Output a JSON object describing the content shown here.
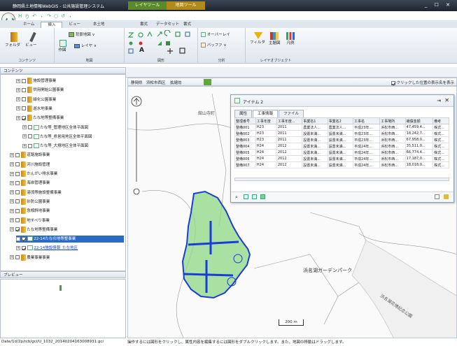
{
  "window": {
    "title": "静岡県土地情報WebGIS - 公共施設管理システム",
    "context_tab1": "レイヤツール",
    "context_tab2": "地図ツール",
    "controls": "_ ☐ ✕"
  },
  "qat": {
    "items": [
      "H",
      "り",
      "↶",
      "・",
      "↷",
      "○",
      "↺",
      "・"
    ]
  },
  "tabs": [
    "ホーム",
    "挿入",
    "ビュー",
    "本土地",
    "書式",
    "データセット",
    "書式"
  ],
  "ribbon": {
    "groups": [
      {
        "label": "コンテンツ",
        "buttons": [
          "フォルダ",
          "ビュー"
        ]
      },
      {
        "label": "地図",
        "buttons": [
          "背景地図 ∨",
          "作図",
          "レイヤ ∨"
        ]
      },
      {
        "label": "図形",
        "buttons": [
          "A"
        ]
      },
      {
        "label": "分析",
        "buttons": [
          "オーバーレイ",
          "バッファ ∨"
        ]
      },
      {
        "label": "レイヤオブジェクト",
        "buttons": [
          "フィルタ",
          "主題図",
          "凡例"
        ]
      }
    ]
  },
  "left_panel": {
    "contents_title": "コンテンツ",
    "preview_title": "プレビュー"
  },
  "tree": [
    {
      "indent": 2,
      "text": "施設管理事業",
      "checked": false
    },
    {
      "indent": 2,
      "text": "供用開始公園事業",
      "checked": false
    },
    {
      "indent": 2,
      "text": "緑化公園事業",
      "checked": false
    },
    {
      "indent": 2,
      "text": "遊水地事業",
      "checked": false
    },
    {
      "indent": 2,
      "text": "たな地等整備事業",
      "checked": true
    },
    {
      "indent": 3,
      "text": "たな等_管理地区全体平面図",
      "checked": false
    },
    {
      "indent": 3,
      "text": "たな等_県営用地区全体平面図",
      "checked": false
    },
    {
      "indent": 3,
      "text": "たな等_大規地区全体平面図",
      "checked": false
    },
    {
      "indent": 1,
      "text": "道路施設事業",
      "checked": false
    },
    {
      "indent": 1,
      "text": "河川施設管理",
      "checked": false
    },
    {
      "indent": 1,
      "text": "かんがい排水事業",
      "checked": false
    },
    {
      "indent": 1,
      "text": "海岸管理事業",
      "checked": false
    },
    {
      "indent": 1,
      "text": "港湾等施設整備事業",
      "checked": false
    },
    {
      "indent": 1,
      "text": "砂防公園事業",
      "checked": false
    },
    {
      "indent": 1,
      "text": "急傾斜地事業",
      "checked": false
    },
    {
      "indent": 1,
      "text": "地すべり事業",
      "checked": false
    },
    {
      "indent": 1,
      "text": "たな地等整備事業",
      "checked": true
    },
    {
      "indent": 2,
      "text": "22-14たなの地等整事業",
      "checked": true,
      "selected": true
    },
    {
      "indent": 2,
      "text": "22-14施設情報_たな地区",
      "checked": true,
      "link": true
    },
    {
      "indent": 1,
      "text": "農業事業事業",
      "checked": false
    }
  ],
  "status": {
    "left": "Date/1d/2p/rcb/gci/U_1032_20140204163008931.gci",
    "right": "操作するには図形をクリックし、属性内容を編集するには図形をダブルクリックします。また、地図の移動はドラッグします。"
  },
  "map_toolbar": {
    "items": [
      "静岡県",
      "浜松市西区",
      "拡縮効"
    ],
    "checkbox_label": "クリックした位置の表示名を表示"
  },
  "map": {
    "scale": "200 m",
    "label1": "浜名湖ガーデンパーク",
    "label2": "浜名湖花博記念公園",
    "label3": "舘山寺町"
  },
  "popup": {
    "title": "アイテム 2",
    "tabs": [
      "属性",
      "工事情報",
      "ファイル"
    ],
    "active_tab": 1,
    "columns": [
      "整理番号",
      "工事年度",
      "工事年度...",
      "事業名1",
      "事業名2",
      "工事名",
      "工事場所",
      "補償金額",
      "備考"
    ],
    "rows": [
      [
        "整備001",
        "H23",
        "2011",
        "農業法人...",
        "農業法人...",
        "平成23年...",
        "浜松市西...",
        "47,459,4...",
        "株式..."
      ],
      [
        "整備002",
        "H23",
        "2011",
        "設置未満...",
        "設置未満...",
        "平成23年...",
        "浜松市西...",
        "18,242,7...",
        "株式..."
      ],
      [
        "整備003",
        "H23",
        "2011",
        "設置未満...",
        "設置未満...",
        "平成23年...",
        "浜松市西...",
        "67,958,0...",
        "株式..."
      ],
      [
        "整備004",
        "H24",
        "2012",
        "設置未満...",
        "設置未満...",
        "平成24年...",
        "浜松市西...",
        "35,511,0...",
        "株式..."
      ],
      [
        "整備005",
        "H24",
        "2012",
        "設置未満...",
        "設置未満...",
        "平成24年...",
        "浜松市西...",
        "66,774,4...",
        "株式..."
      ],
      [
        "整備006",
        "H24",
        "2012",
        "設置未満...",
        "設置未満...",
        "平成24年...",
        "浜松市西...",
        "17,187,0...",
        "株式..."
      ],
      [
        "整備007",
        "H24",
        "2012",
        "設置未満...",
        "設置未満...",
        "平成24年...",
        "浜松市西...",
        "18,018,0...",
        "株式..."
      ]
    ]
  },
  "colors": {
    "accent": "#2a6cc4",
    "polygon_fill": "#7fd07a",
    "polygon_stroke": "#1a3cd8",
    "titlebar": "#2b3440"
  }
}
